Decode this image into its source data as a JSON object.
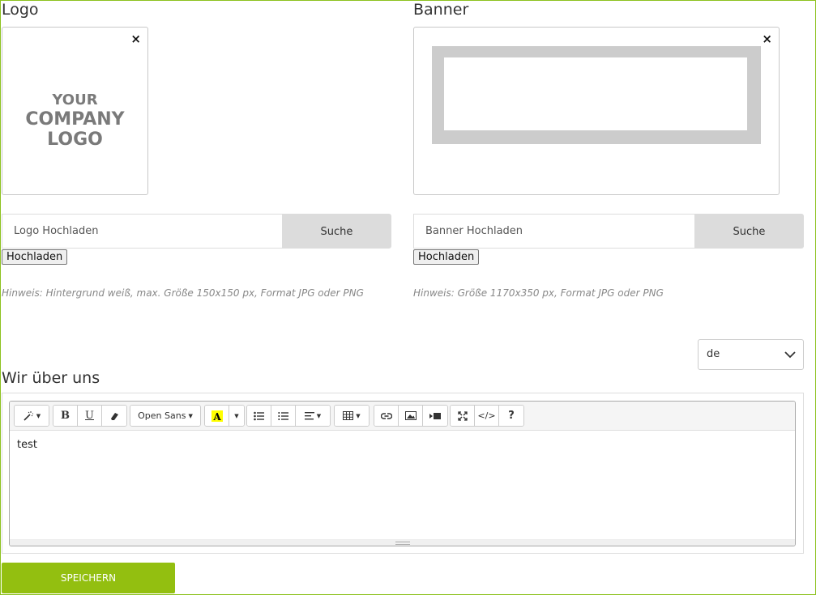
{
  "logo": {
    "title": "Logo",
    "placeholder_lines": [
      "YOUR",
      "COMPANY",
      "LOGO"
    ],
    "file_placeholder": "Logo Hochladen",
    "browse_label": "Suche",
    "upload_label": "Hochladen",
    "hint": "Hinweis: Hintergrund weiß, max. Größe 150x150 px, Format JPG oder PNG",
    "remove_label": "×"
  },
  "banner": {
    "title": "Banner",
    "file_placeholder": "Banner Hochladen",
    "browse_label": "Suche",
    "upload_label": "Hochladen",
    "hint": "Hinweis: Größe 1170x350 px, Format JPG oder PNG",
    "remove_label": "×"
  },
  "language": {
    "selected": "de"
  },
  "about": {
    "title": "Wir über uns",
    "content": "test",
    "toolbar": {
      "font_name": "Open Sans",
      "bold": "B",
      "underline": "U",
      "help": "?",
      "code": "</>"
    }
  },
  "save_label": "SPEICHERN",
  "colors": {
    "accent": "#93bf10",
    "frame": "#8dc21f",
    "highlight": "#ffff00"
  }
}
